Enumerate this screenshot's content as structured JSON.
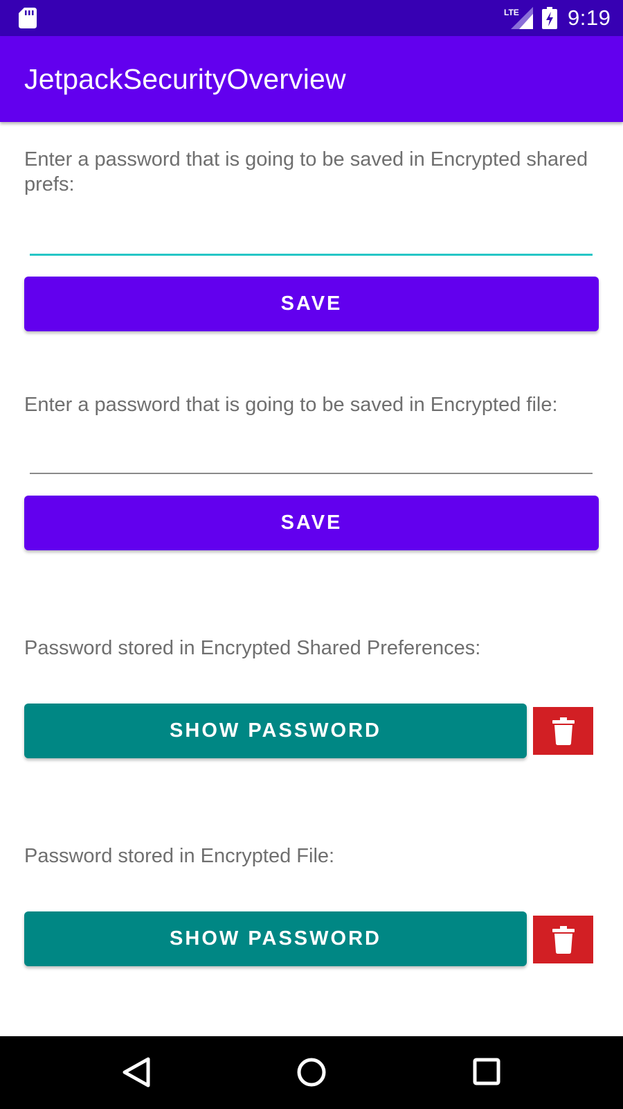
{
  "status_bar": {
    "network": "LTE",
    "time": "9:19",
    "icons": [
      "sd-card-icon",
      "lte-signal-icon",
      "battery-charging-icon"
    ]
  },
  "app_bar": {
    "title": "JetpackSecurityOverview"
  },
  "shared_prefs_section": {
    "label": "Enter a password that is going to be saved in Encrypted shared prefs:",
    "input_value": "",
    "save_label": "SAVE"
  },
  "file_section": {
    "label": "Enter a password that is going to be saved in Encrypted file:",
    "input_value": "",
    "save_label": "SAVE"
  },
  "stored_shared_prefs": {
    "label": "Password stored in Encrypted Shared Preferences:",
    "show_label": "SHOW PASSWORD",
    "delete_icon": "trash-icon"
  },
  "stored_file": {
    "label": "Password stored in Encrypted File:",
    "show_label": "SHOW PASSWORD",
    "delete_icon": "trash-icon"
  },
  "nav_bar": {
    "icons": [
      "back-icon",
      "home-icon",
      "recents-icon"
    ]
  },
  "colors": {
    "status_bar": "#3700b3",
    "primary": "#6200ee",
    "accent_underline": "#26c6c6",
    "teal_button": "#008784",
    "delete_button": "#d21f24"
  }
}
